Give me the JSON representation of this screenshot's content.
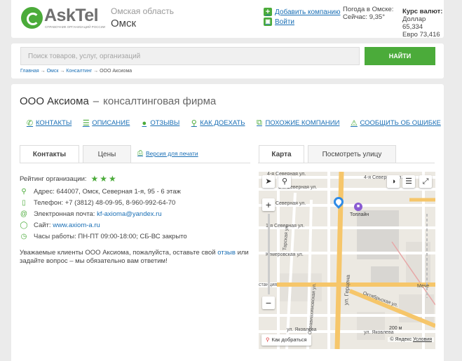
{
  "header": {
    "logo_text": "AskTel",
    "logo_subtitle": "СПРАВОЧНИК ОРГАНИЗАЦИЙ РОССИИ",
    "region": "Омская область",
    "city": "Омск",
    "add_company": "Добавить компанию",
    "login": "Войти",
    "weather_title": "Погода в Омске:",
    "weather_now": "Сейчас: 9,35°",
    "rates_title": "Курс валют:",
    "usd": "Доллар 65,334",
    "eur": "Евро 73,416"
  },
  "search": {
    "placeholder": "Поиск товаров, услуг, организаций",
    "button": "НАЙТИ"
  },
  "breadcrumb": [
    "Главная",
    "Омск",
    "Консалтинг",
    "ООО Аксиома"
  ],
  "breadcrumb_separator": "→",
  "company": {
    "name": "ООО Аксиома",
    "dash": "–",
    "type": "консалтинговая фирма"
  },
  "nav": [
    {
      "label": "КОНТАКТЫ",
      "icon": "phone-icon"
    },
    {
      "label": "ОПИСАНИЕ",
      "icon": "list-icon"
    },
    {
      "label": "ОТЗЫВЫ",
      "icon": "comment-icon"
    },
    {
      "label": "КАК ДОЕХАТЬ",
      "icon": "map-pin-icon"
    },
    {
      "label": "ПОХОЖИЕ КОМПАНИИ",
      "icon": "copy-icon"
    },
    {
      "label": "СООБЩИТЬ ОБ ОШИБКЕ",
      "icon": "warning-icon"
    }
  ],
  "tabs": {
    "contacts": "Контакты",
    "prices": "Цены",
    "print": "Версия для печати",
    "map": "Карта",
    "street": "Посмотреть улицу"
  },
  "info": {
    "rating_label": "Рейтинг организации:",
    "rating": 3,
    "rating_max": 3,
    "address": "Адрес: 644007, Омск, Северная 1-я, 95 - 6 этаж",
    "phone": "Телефон: +7 (3812) 48-09-95, 8-960-992-64-70",
    "email_label": "Электронная почта:",
    "email": "kf-axioma@yandex.ru",
    "site_label": "Сайт:",
    "site": "www.axiom-a.ru",
    "hours": "Часы работы: ПН-ПТ 09:00-18:00; СБ-ВС закрыто",
    "notice_before": "Уважаемые клиенты ООО Аксиома, пожалуйста, оставьте свой",
    "notice_link": "отзыв",
    "notice_after": "или задайте вопрос – мы обязательно вам ответим!"
  },
  "map": {
    "streets": [
      "4-я Северная ул.",
      "4-я Северная ул.",
      "3-я Северная ул.",
      "2-я Северная ул.",
      "1-я Северная ул.",
      "Тарская ул.",
      "Кемеровская ул.",
      "ул. Герцена",
      "Осоавиахимовская ул.",
      "Октябрьская ул.",
      "ул. Яковлева",
      "ул. Яковлева"
    ],
    "poi": "Топлайн",
    "poi_station": "станция",
    "poi_meche": "Мече",
    "route": "Как добраться",
    "scale": "200 м",
    "copyright": "© Яндекс",
    "terms": "Условия"
  },
  "colors": {
    "brand_green": "#4bab3a",
    "link_blue": "#1a6fb5",
    "road_yellow": "#f6c66a"
  }
}
